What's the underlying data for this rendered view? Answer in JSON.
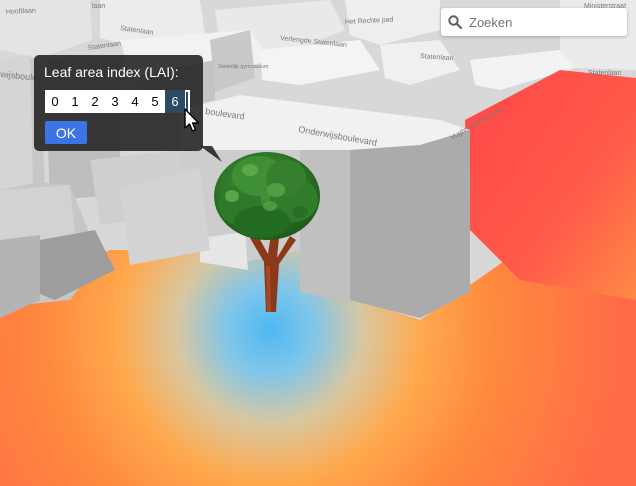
{
  "search": {
    "placeholder": "Zoeken",
    "icon": "search-icon"
  },
  "popup": {
    "title": "Leaf area index (LAI):",
    "options": [
      "0",
      "1",
      "2",
      "3",
      "4",
      "5",
      "6"
    ],
    "selected": "6",
    "ok_label": "OK"
  },
  "map_labels": {
    "hooftlaan": "Hooftlaan",
    "ministerstraat": "Ministerstraat",
    "laan_tl": "laan",
    "hel_rechte_pad": "Het Rechte pad",
    "statenlaan": "Statenlaan",
    "verlengde_statenlaan": "Verlengde Statenlaan",
    "statenlaan_2": "Statenlaan",
    "statenlaan_3": "Statenlaan",
    "weijsboulevard": "wijsboule",
    "gymnasium": "Stedelijk gymnasium",
    "onderwijsboulevard": "Onderwijsboulevard",
    "onderwijsboulevard_2": "boulevard",
    "vughterweg": "Vught. Broekhaven",
    "statenlaan_left": "Statenlaan"
  },
  "colors": {
    "popup_bg": "#262626",
    "ok_button": "#3d74e5",
    "selected_option": "#2c4a64",
    "heat_hot": "#ff4b4b",
    "heat_warm": "#ff9a3c",
    "heat_cool": "#5ab8f0"
  }
}
